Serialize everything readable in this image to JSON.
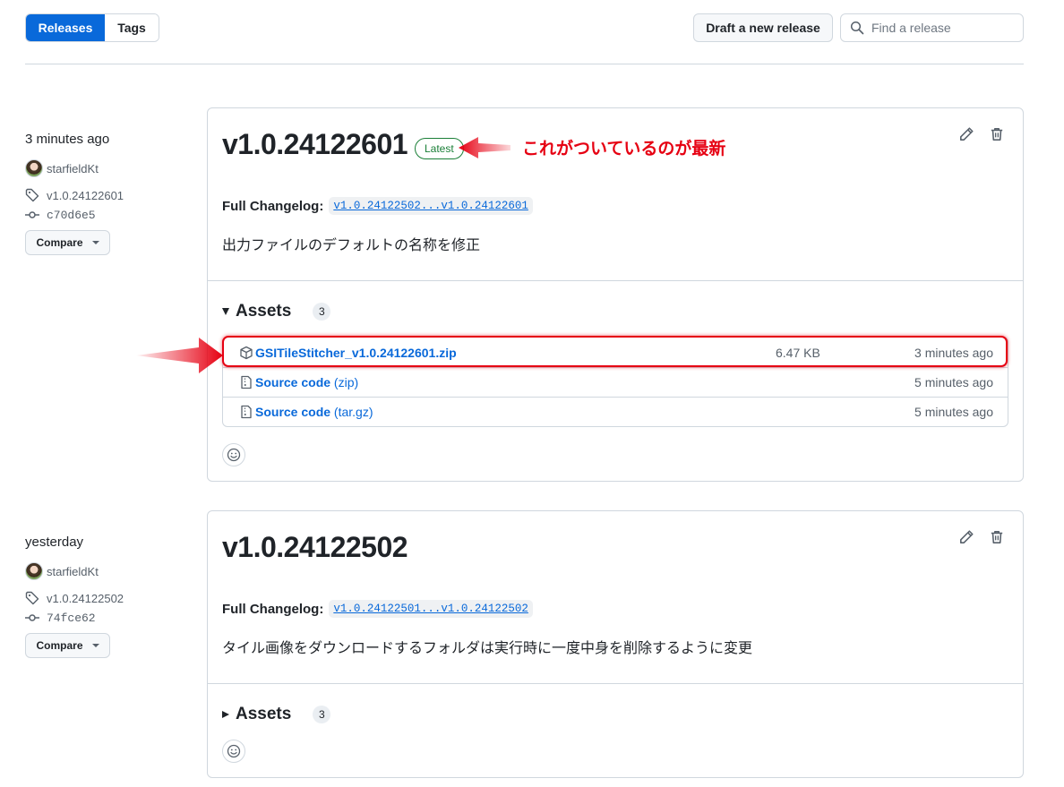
{
  "toolbar": {
    "tabs": [
      "Releases",
      "Tags"
    ],
    "draft_label": "Draft a new release",
    "search_placeholder": "Find a release"
  },
  "releases": [
    {
      "time": "3 minutes ago",
      "author": "starfieldKt",
      "tag": "v1.0.24122601",
      "commit": "c70d6e5",
      "compare_label": "Compare",
      "title": "v1.0.24122601",
      "latest_label": "Latest",
      "changelog_label": "Full Changelog:",
      "changelog_link": "v1.0.24122502...v1.0.24122601",
      "body": "出力ファイルのデフォルトの名称を修正",
      "assets_label": "Assets",
      "assets_count": "3",
      "assets": [
        {
          "name": "GSITileStitcher_v1.0.24122601.zip",
          "suffix": "",
          "size": "6.47 KB",
          "time": "3 minutes ago",
          "icon": "package-icon"
        },
        {
          "name": "Source code",
          "suffix": " (zip)",
          "size": "",
          "time": "5 minutes ago",
          "icon": "file-zip-icon"
        },
        {
          "name": "Source code",
          "suffix": " (tar.gz)",
          "size": "",
          "time": "5 minutes ago",
          "icon": "file-zip-icon"
        }
      ]
    },
    {
      "time": "yesterday",
      "author": "starfieldKt",
      "tag": "v1.0.24122502",
      "commit": "74fce62",
      "compare_label": "Compare",
      "title": "v1.0.24122502",
      "changelog_label": "Full Changelog:",
      "changelog_link": "v1.0.24122501...v1.0.24122502",
      "body": "タイル画像をダウンロードするフォルダは実行時に一度中身を削除するように変更",
      "assets_label": "Assets",
      "assets_count": "3"
    }
  ],
  "annotation": {
    "text": "これがついているのが最新",
    "color": "#e60012"
  }
}
